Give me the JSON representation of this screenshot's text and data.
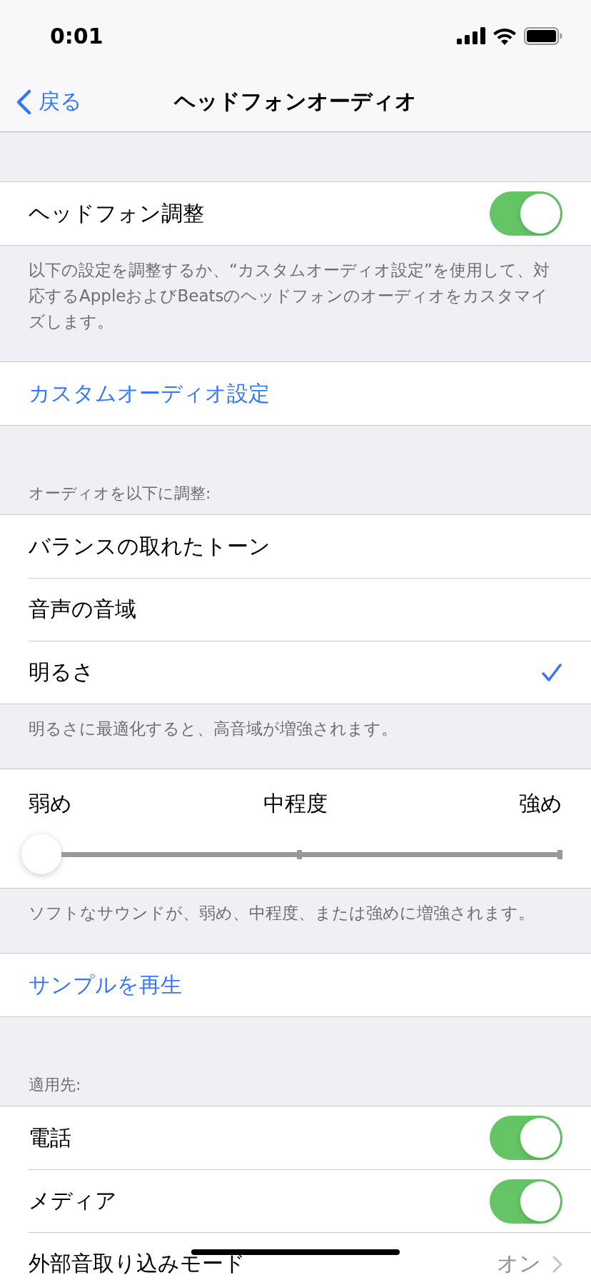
{
  "status_bar": {
    "time": "0:01"
  },
  "nav": {
    "back": "戻る",
    "title": "ヘッドフォンオーディオ"
  },
  "sections": [
    {
      "rows": [
        {
          "kind": "toggle",
          "label": "ヘッドフォン調整",
          "on": true
        }
      ],
      "footer": "以下の設定を調整するか、“カスタムオーディオ設定”を使用して、対応するAppleおよびBeatsのヘッドフォンのオーディオをカスタマイズします。"
    },
    {
      "rows": [
        {
          "kind": "link",
          "label": "カスタムオーディオ設定"
        }
      ]
    },
    {
      "header": "オーディオを以下に調整:",
      "rows": [
        {
          "kind": "option",
          "label": "バランスの取れたトーン",
          "selected": false
        },
        {
          "kind": "option",
          "label": "音声の音域",
          "selected": false
        },
        {
          "kind": "option",
          "label": "明るさ",
          "selected": true
        }
      ],
      "footer": "明るさに最適化すると、高音域が増強されます。"
    },
    {
      "rows": [
        {
          "kind": "slider",
          "labels": [
            "弱め",
            "中程度",
            "強め"
          ],
          "level": 0
        }
      ],
      "footer": "ソフトなサウンドが、弱め、中程度、または強めに増強されます。"
    },
    {
      "rows": [
        {
          "kind": "link",
          "label": "サンプルを再生"
        }
      ]
    },
    {
      "header": "適用先:",
      "rows": [
        {
          "kind": "toggle",
          "label": "電話",
          "on": true
        },
        {
          "kind": "toggle",
          "label": "メディア",
          "on": true
        },
        {
          "kind": "disclosure",
          "label": "外部音取り込みモード",
          "value": "オン"
        }
      ]
    }
  ]
}
